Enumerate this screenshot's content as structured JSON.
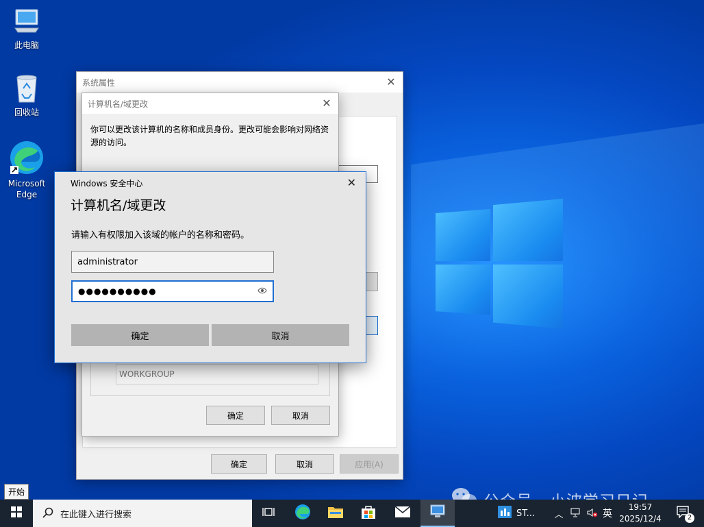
{
  "desktop": {
    "icons": [
      {
        "label": "此电脑",
        "icon": "computer-icon"
      },
      {
        "label": "回收站",
        "icon": "recycle-bin-icon"
      },
      {
        "label": "Microsoft Edge",
        "icon": "edge-icon"
      }
    ]
  },
  "sysprops": {
    "title": "系统属性",
    "ok": "确定",
    "cancel": "取消",
    "apply": "应用(A)"
  },
  "namechange": {
    "title": "计算机名/域更改",
    "description": "你可以更改该计算机的名称和成员身份。更改可能会影响对网络资源的访问。",
    "workgroup_value": "WORKGROUP",
    "ok": "确定",
    "cancel": "取消"
  },
  "security": {
    "app_title": "Windows 安全中心",
    "heading": "计算机名/域更改",
    "prompt": "请输入有权限加入该域的帐户的名称和密码。",
    "username": "administrator",
    "password_mask": "●●●●●●●●●●",
    "ok": "确定",
    "cancel": "取消"
  },
  "tooltip": {
    "start": "开始"
  },
  "taskbar": {
    "search_placeholder": "在此键入进行搜索",
    "running_app_label": "ST...",
    "ime": "英",
    "time": "19:57",
    "date": "2025/12/4",
    "notifications": "2"
  },
  "watermark": {
    "text": "公众号 · 小波学习日记"
  },
  "colors": {
    "accent": "#1f6fd2",
    "desktop": "#0a63df",
    "taskbar": "#1a2430"
  }
}
